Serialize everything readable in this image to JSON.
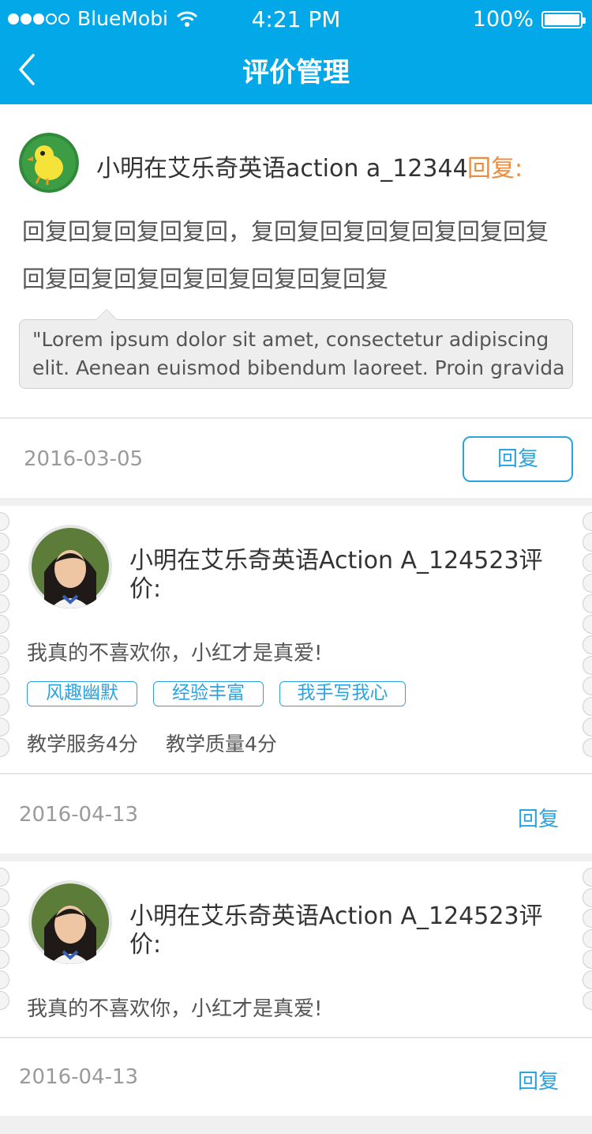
{
  "status_bar": {
    "carrier": "BlueMobi",
    "time": "4:21 PM",
    "battery": "100%"
  },
  "header": {
    "title": "评价管理",
    "back_icon": "chevron-left-icon"
  },
  "colors": {
    "header_bg": "#03a8e8",
    "accent": "#2aa3e0",
    "orange": "#f08a3c"
  },
  "reply_card": {
    "author": "小明在艾乐奇英语action a_12344",
    "reply_label": "回复:",
    "body_line1": "回复回复回复回复回，复回复回复回复回复回复回复",
    "body_line2": "回复回复回复回复回复回复回复回复",
    "quote_line1": "\"Lorem ipsum dolor sit amet, consectetur adipiscing",
    "quote_line2": "elit. Aenean euismod bibendum laoreet. Proin gravida",
    "date": "2016-03-05",
    "reply_button": "回复"
  },
  "reviews": [
    {
      "title_line1": "小明在艾乐奇英语Action A_124523评",
      "title_line2": "价:",
      "comment": "我真的不喜欢你，小红才是真爱!",
      "tags": [
        "风趣幽默",
        "经验丰富",
        "我手写我心"
      ],
      "service_score": "教学服务4分",
      "quality_score": "教学质量4分",
      "date": "2016-04-13",
      "reply": "回复"
    },
    {
      "title_line1": "小明在艾乐奇英语Action A_124523评",
      "title_line2": "价:",
      "comment": "我真的不喜欢你，小红才是真爱!",
      "date": "2016-04-13",
      "reply": "回复"
    }
  ]
}
